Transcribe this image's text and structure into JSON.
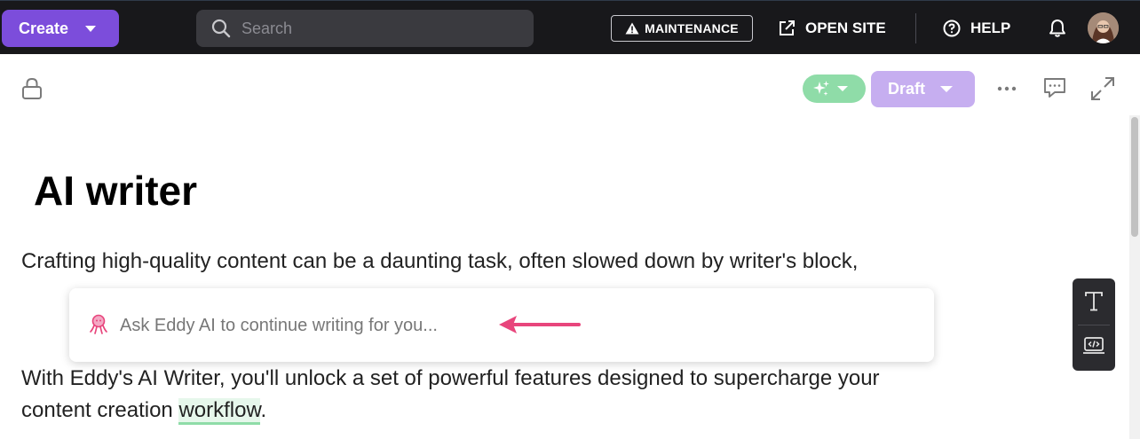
{
  "topbar": {
    "create_label": "Create",
    "search_placeholder": "Search",
    "maintenance_label": "MAINTENANCE",
    "open_site_label": "OPEN SITE",
    "help_label": "HELP",
    "icons": [
      "caret-down-icon",
      "search-icon",
      "warning-icon",
      "external-link-icon",
      "help-icon",
      "bell-icon",
      "avatar"
    ]
  },
  "editor_toolbar": {
    "status_label": "Draft",
    "icons": [
      "lock-icon",
      "sparkles-icon",
      "caret-down-icon",
      "more-icon",
      "comment-icon",
      "expand-icon"
    ]
  },
  "document": {
    "title": "AI writer",
    "paragraph1": "Crafting high-quality content can be a daunting task, often slowed down by writer's block,",
    "paragraph2_before": "With Eddy's AI Writer, you'll unlock a set of powerful features designed to supercharge your",
    "paragraph2_line2_before": "content creation ",
    "paragraph2_highlight": "workflow",
    "paragraph2_after": "."
  },
  "ai_prompt": {
    "placeholder": "Ask Eddy AI to continue writing for you..."
  },
  "side_tools": {
    "icons": [
      "text-icon",
      "code-block-icon"
    ]
  },
  "colors": {
    "topbar_bg": "#18181b",
    "create_purple": "#7c4ddb",
    "draft_lavender": "#c6aef0",
    "ai_green": "#8fdca8",
    "arrow_pink": "#e8457c"
  }
}
